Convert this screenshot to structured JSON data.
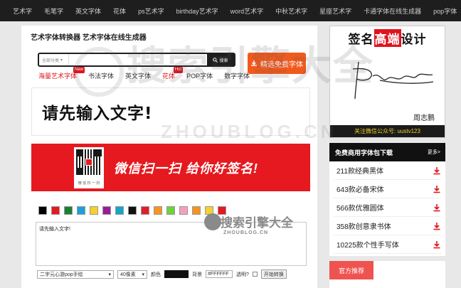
{
  "topnav": [
    "艺术字",
    "毛笔字",
    "英文字体",
    "花体",
    "ps艺术字",
    "birthday艺术字",
    "word艺术字",
    "中秋艺术字",
    "星座艺术字",
    "卡通字体在线生成器",
    "pop字体"
  ],
  "page": {
    "title": "艺术字体转换器 艺术字体在线生成器",
    "search_category": "全部分类",
    "search_button": "搜索",
    "free_button": "精选免费字体"
  },
  "tabs": [
    {
      "label": "海量艺术字体",
      "badge": "New",
      "red": true
    },
    {
      "label": "书法字体",
      "badge": "",
      "red": false
    },
    {
      "label": "英文字体",
      "badge": "",
      "red": false
    },
    {
      "label": "花体",
      "badge": "Hot",
      "red": true
    },
    {
      "label": "POP字体",
      "badge": "",
      "red": false
    },
    {
      "label": "数字字体",
      "badge": "",
      "red": false
    }
  ],
  "preview_text": "请先输入文字!",
  "banner": {
    "text": "微信扫一扫 给你好签名!",
    "qr_caption": "微 信 扫 一 扫"
  },
  "swatches": [
    "#000000",
    "#e5191f",
    "#1a7f2e",
    "#1f9fd8",
    "#f3d12e",
    "#9b1b95",
    "#15a6c6",
    "#111111",
    "#e21d2a",
    "#f7941d",
    "#6ad43a",
    "#f5a0b8",
    "#f7941d",
    "#f3d12e",
    "#e5191f"
  ],
  "editor": {
    "textarea_value": "请先输入文字!",
    "font_select": "二字元心游pop手绘",
    "size_select": "40像素",
    "color_label": "颜色",
    "bg_label": "背景",
    "bg_value": "#FFFFFF",
    "transparent_label": "透明?",
    "convert_button": "开始转换"
  },
  "ad": {
    "head_pre": "签名",
    "head_hl": "高端",
    "head_post": "设计",
    "name": "周志鹏",
    "footer": "关注微信公众号: uustv123"
  },
  "downloads": {
    "title": "免费商用字体包下载",
    "more": "更多>",
    "items": [
      "211款经典黑体",
      "643款必备宋体",
      "566款优雅圆体",
      "358款创意隶书体",
      "10225款个性手写体"
    ]
  },
  "recommend": {
    "title": "官方推荐"
  },
  "watermark": {
    "big": "搜索引擎大全",
    "big_sub": "ZHOUBLOG.CN",
    "small": "搜索引擎大全",
    "small_sub": "ZHOUBLOG.CN"
  },
  "colors": {
    "accent_red": "#e0141e",
    "orange": "#f25a1d",
    "nav_bg": "#1e1e1e"
  }
}
